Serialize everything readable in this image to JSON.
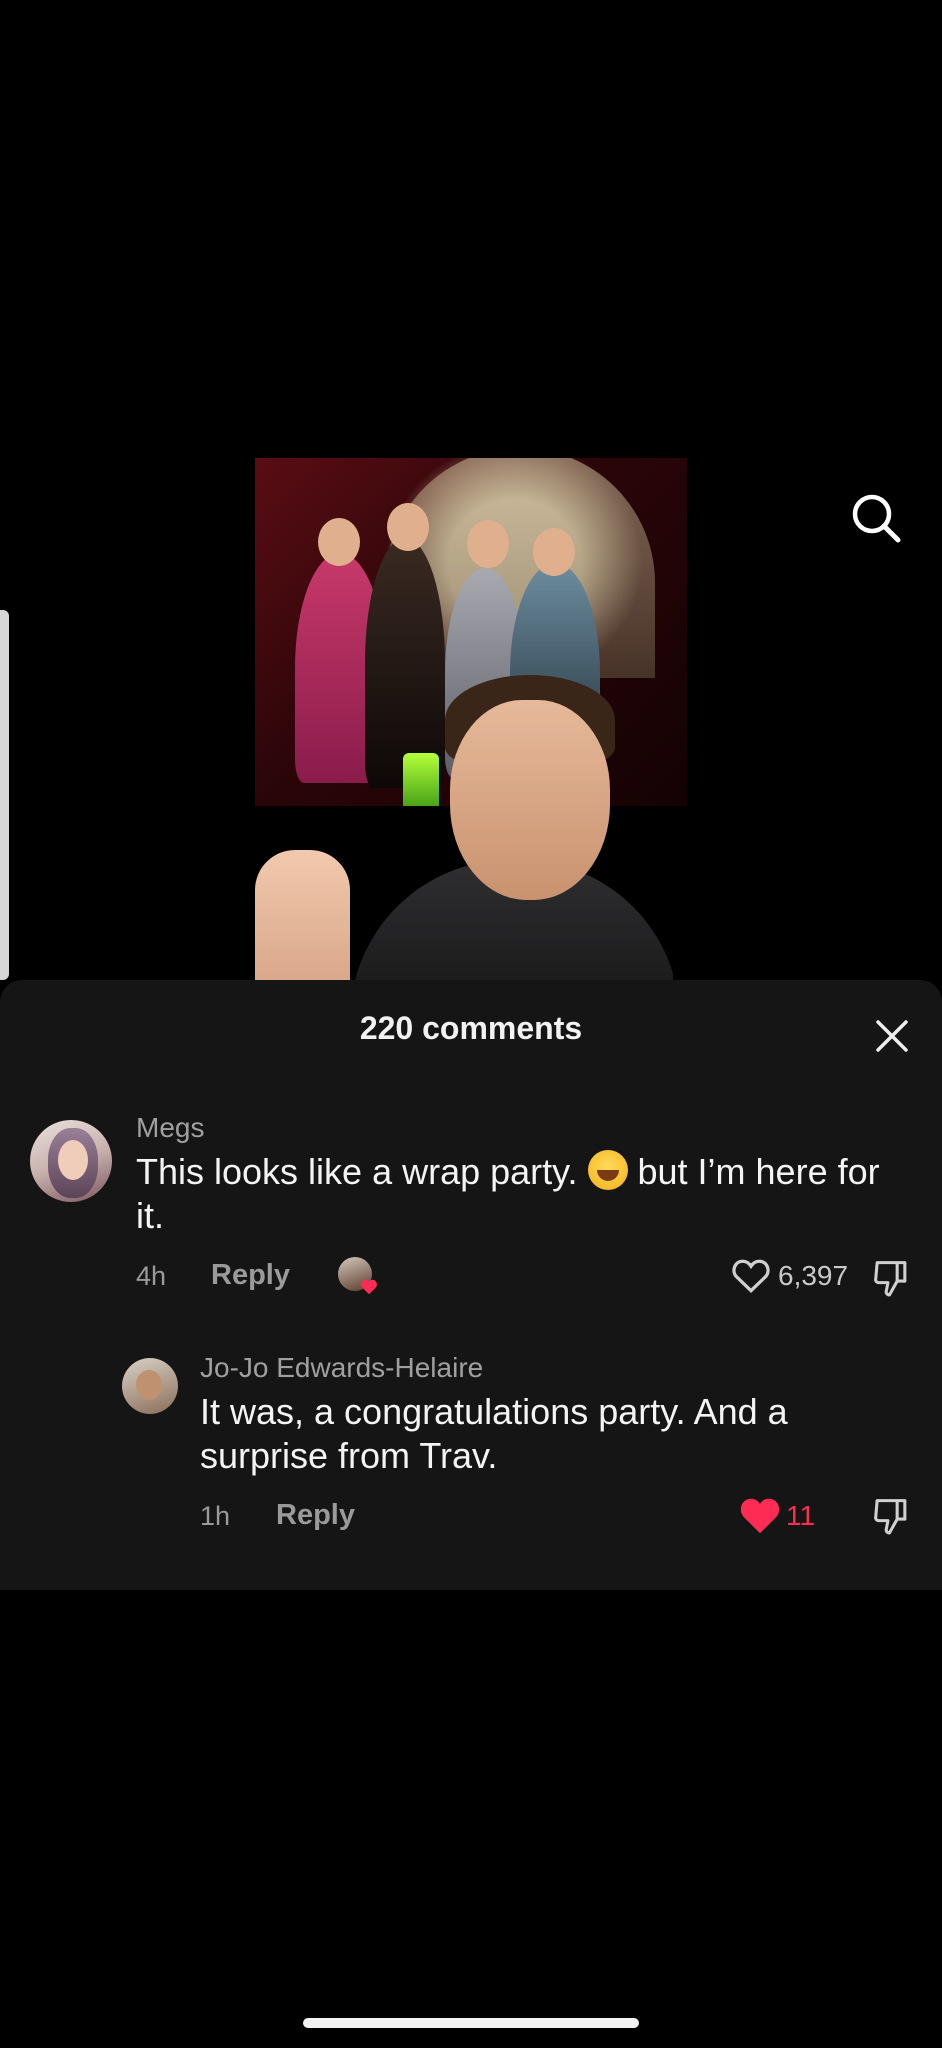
{
  "panel": {
    "title": "220 comments",
    "close_icon": "close-icon"
  },
  "video": {
    "search_icon": "search-icon"
  },
  "comments": [
    {
      "username": "Megs",
      "text_before_emoji": "This looks like a wrap party. ",
      "emoji": "grinning-sweat-emoji",
      "text_after_emoji": " but I’m here for it.",
      "time": "4h",
      "reply_label": "Reply",
      "likes": "6,397",
      "liked": false
    },
    {
      "username": "Jo-Jo Edwards-Helaire",
      "text": "It was, a congratulations party. And a surprise from Trav.",
      "time": "1h",
      "reply_label": "Reply",
      "likes": "11",
      "liked": true
    }
  ],
  "colors": {
    "accent_like": "#fe2c55",
    "panel_bg": "#151515",
    "muted_text": "#9a9a9a"
  }
}
